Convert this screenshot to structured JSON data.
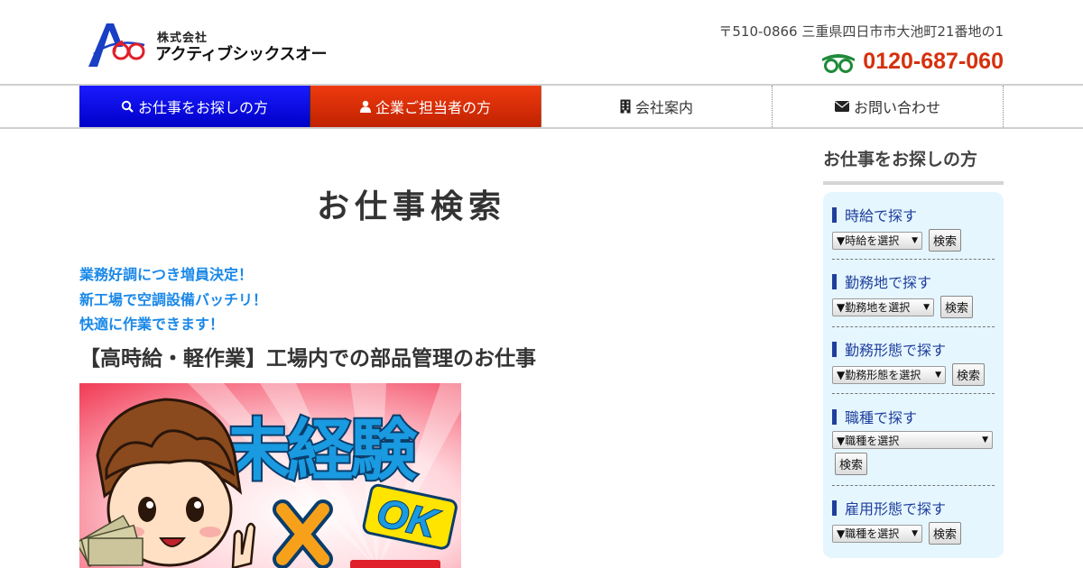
{
  "header": {
    "logo_small": "株式会社",
    "logo_big": "アクティブシックスオー",
    "address": "〒510-0866 三重県四日市市大池町21番地の1",
    "phone": "0120-687-060"
  },
  "nav": {
    "items": [
      {
        "label": "お仕事をお探しの方",
        "icon": "search-icon"
      },
      {
        "label": "企業ご担当者の方",
        "icon": "user-icon"
      },
      {
        "label": "会社案内",
        "icon": "building-icon"
      },
      {
        "label": "お問い合わせ",
        "icon": "envelope-icon"
      }
    ]
  },
  "main": {
    "title": "お仕事検索",
    "lead": [
      "業務好調につき増員決定！",
      "新工場で空調設備バッチリ！",
      "快適に作業できます！"
    ],
    "job_title": "【高時給・軽作業】工場内での部品管理のお仕事",
    "banner": {
      "line1": "未経験",
      "line2": "OK"
    }
  },
  "sidebar": {
    "heading": "お仕事をお探しの方",
    "sections": [
      {
        "label": "時給で探す",
        "select": "▼時給を選択",
        "button": "検索"
      },
      {
        "label": "勤務地で探す",
        "select": "▼勤務地を選択",
        "button": "検索"
      },
      {
        "label": "勤務形態で探す",
        "select": "▼勤務形態を選択",
        "button": "検索"
      },
      {
        "label": "職種で探す",
        "select": "▼職種を選択",
        "button": "検索"
      },
      {
        "label": "雇用形態で探す",
        "select": "▼職種を選択",
        "button": "検索"
      }
    ]
  },
  "colors": {
    "nav_blue": "#0000d8",
    "nav_red": "#d62a05",
    "phone": "#d6300e",
    "lead": "#1a88e8",
    "sidebar_bg": "#e5f6ff",
    "sidebar_label": "#1f3f9c"
  }
}
